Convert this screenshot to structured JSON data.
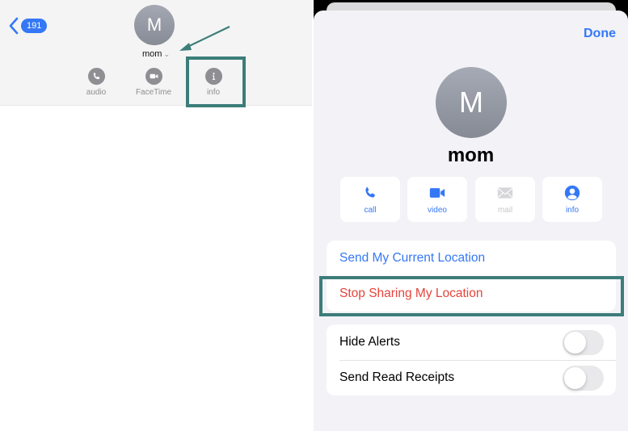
{
  "left": {
    "back_badge": "191",
    "avatar_initial": "M",
    "contact_name": "mom",
    "actions": [
      {
        "label": "audio",
        "icon": "phone-icon"
      },
      {
        "label": "FaceTime",
        "icon": "video-camera-icon"
      },
      {
        "label": "info",
        "icon": "info-icon"
      }
    ],
    "annotation_color": "#3c7d79"
  },
  "right": {
    "done_label": "Done",
    "avatar_initial": "M",
    "contact_name": "mom",
    "actions": [
      {
        "label": "call",
        "icon": "phone-icon",
        "enabled": true
      },
      {
        "label": "video",
        "icon": "video-camera-icon",
        "enabled": true
      },
      {
        "label": "mail",
        "icon": "envelope-icon",
        "enabled": false
      },
      {
        "label": "info",
        "icon": "person-circle-icon",
        "enabled": true
      }
    ],
    "location_group": [
      {
        "label": "Send My Current Location",
        "color": "#3478f6"
      },
      {
        "label": "Stop Sharing My Location",
        "color": "#e5443b"
      }
    ],
    "settings_group": [
      {
        "label": "Hide Alerts",
        "toggle_on": false
      },
      {
        "label": "Send Read Receipts",
        "toggle_on": false
      }
    ]
  },
  "colors": {
    "accent": "#3478f6",
    "destructive": "#e5443b",
    "annotation": "#3c7d79"
  }
}
